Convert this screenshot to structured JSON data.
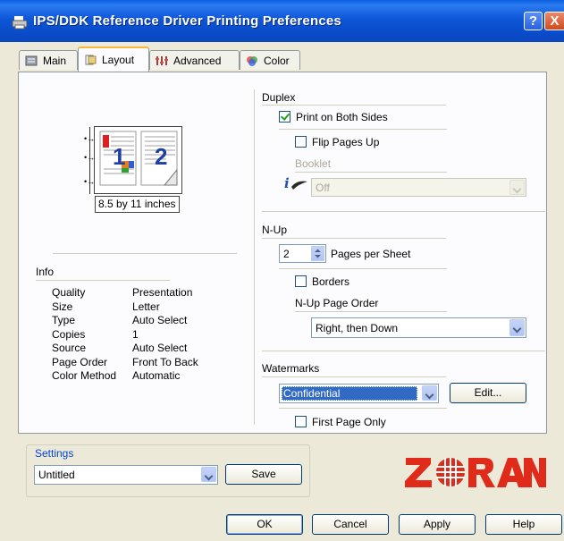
{
  "window": {
    "title": "IPS/DDK Reference Driver Printing Preferences",
    "help_label": "?",
    "close_label": "X"
  },
  "tabs": [
    {
      "label": "Main",
      "icon": "main-tab-icon"
    },
    {
      "label": "Layout",
      "icon": "layout-tab-icon"
    },
    {
      "label": "Advanced",
      "icon": "advanced-tab-icon"
    },
    {
      "label": "Color",
      "icon": "color-tab-icon"
    }
  ],
  "preview": {
    "page1": "1",
    "page2": "2",
    "size_label": "8.5 by 11 inches"
  },
  "info": {
    "heading": "Info",
    "rows": [
      {
        "label": "Quality",
        "value": "Presentation"
      },
      {
        "label": "Size",
        "value": "Letter"
      },
      {
        "label": "Type",
        "value": "Auto Select"
      },
      {
        "label": "Copies",
        "value": "1"
      },
      {
        "label": "Source",
        "value": "Auto Select"
      },
      {
        "label": "Page Order",
        "value": "Front To Back"
      },
      {
        "label": "Color Method",
        "value": "Automatic"
      }
    ]
  },
  "duplex": {
    "heading": "Duplex",
    "print_both_sides": {
      "label": "Print on Both Sides",
      "checked": true
    },
    "flip_pages_up": {
      "label": "Flip Pages Up",
      "checked": false
    },
    "booklet_label": "Booklet",
    "booklet_value": "Off"
  },
  "nup": {
    "heading": "N-Up",
    "pages_value": "2",
    "pages_label": "Pages per Sheet",
    "borders": {
      "label": "Borders",
      "checked": false
    },
    "order_label": "N-Up Page Order",
    "order_value": "Right, then Down"
  },
  "watermarks": {
    "heading": "Watermarks",
    "value": "Confidential",
    "edit_label": "Edit...",
    "first_page_only": {
      "label": "First Page Only",
      "checked": false
    }
  },
  "settings": {
    "label": "Settings",
    "value": "Untitled",
    "save_label": "Save"
  },
  "brand": {
    "logo_text": "ZORAN",
    "color": "#e02a1a"
  },
  "buttons": {
    "ok": "OK",
    "cancel": "Cancel",
    "apply": "Apply",
    "help": "Help"
  },
  "colors": {
    "accent": "#0a46c0",
    "selection": "#316ac5"
  }
}
